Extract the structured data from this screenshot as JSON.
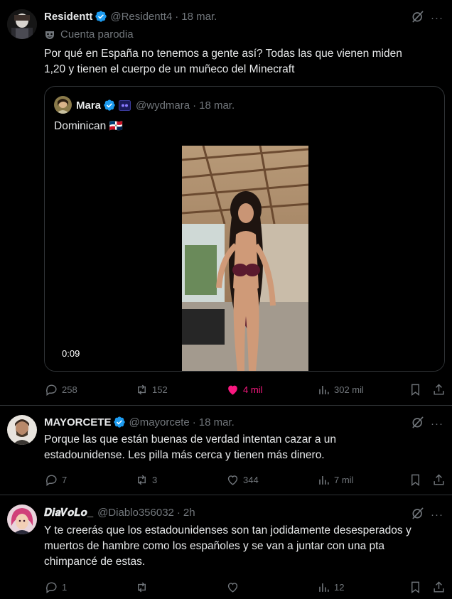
{
  "tweets": [
    {
      "name": "Residentt",
      "handle": "@Residentt4",
      "date": "18 mar.",
      "parody_label": "Cuenta parodia",
      "text_lines": [
        "Por qué en España no tenemos a gente así? Todas las que vienen miden",
        "1,20 y tienen el cuerpo de un muñeco del Minecraft"
      ],
      "quote": {
        "name": "Mara",
        "handle": "@wydmara",
        "date": "18 mar.",
        "text": "Dominican 🇩🇴",
        "video_time": "0:09"
      },
      "stats": {
        "replies": "258",
        "retweets": "152",
        "likes": "4 mil",
        "views": "302 mil"
      }
    },
    {
      "name": "MAYORCETE",
      "handle": "@mayorcete",
      "date": "18 mar.",
      "text_lines": [
        "Porque las que están buenas de verdad intentan cazar a un",
        "estadounidense. Les pilla más cerca y tienen más dinero."
      ],
      "stats": {
        "replies": "7",
        "retweets": "3",
        "likes": "344",
        "views": "7 mil"
      }
    },
    {
      "name": "𝑫𝒊𝒂𝑽𝒐𝑳𝒐_",
      "handle": "@Diablo356032",
      "date": "2h",
      "text_lines": [
        "Y te creerás que los estadounidenses son tan jodidamente desesperados y",
        "muertos de hambre como los españoles y se van a juntar con una pta",
        "chimpancé de estas."
      ],
      "stats": {
        "replies": "1",
        "retweets": "",
        "likes": "",
        "views": "12"
      }
    }
  ],
  "colors": {
    "verified": "#1d9bf0",
    "like_active": "#f91880",
    "muted": "#71767b",
    "border": "#2f3336"
  }
}
